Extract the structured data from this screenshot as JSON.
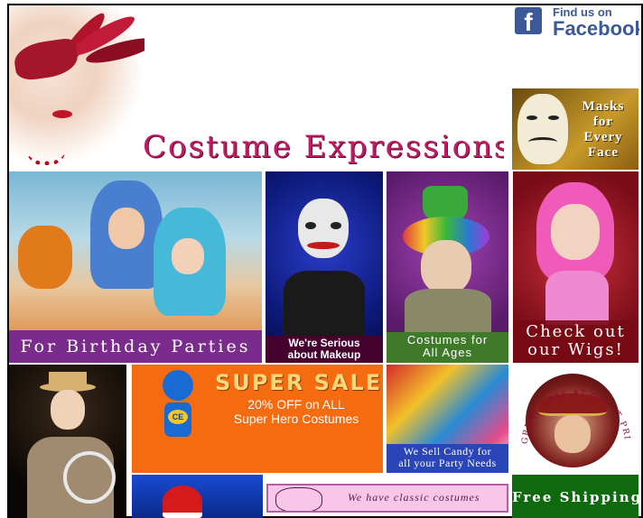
{
  "header": {
    "title": "Costume Expressions",
    "facebook": {
      "line1": "Find us on",
      "line2": "Facebook",
      "logo_letter": "f"
    }
  },
  "promos": {
    "masks": [
      "Masks",
      "for",
      "Every",
      "Face"
    ],
    "birthday": "For Birthday Parties",
    "makeup": [
      "We're Serious",
      "about Makeup"
    ],
    "ages": [
      "Costumes for",
      "All Ages"
    ],
    "wigs": [
      "Check out",
      "our Wigs!"
    ],
    "sale": {
      "title": "SUPER SALE",
      "line1": "20% OFF on ALL",
      "line2": "Super Hero Costumes",
      "hero_badge": "CE"
    },
    "candy": [
      "We Sell Candy for",
      "all your Party Needs"
    ],
    "hats": "GREAT HATS AT GREAT PRICES",
    "classic": "We have classic costumes",
    "shipping": "Free Shipping"
  },
  "colors": {
    "title_pink": "#c21b66",
    "facebook_blue": "#3b5998",
    "birthday_band": "#7a2b8c",
    "sale_orange": "#f46b10",
    "shipping_green": "#0f6a0f"
  }
}
